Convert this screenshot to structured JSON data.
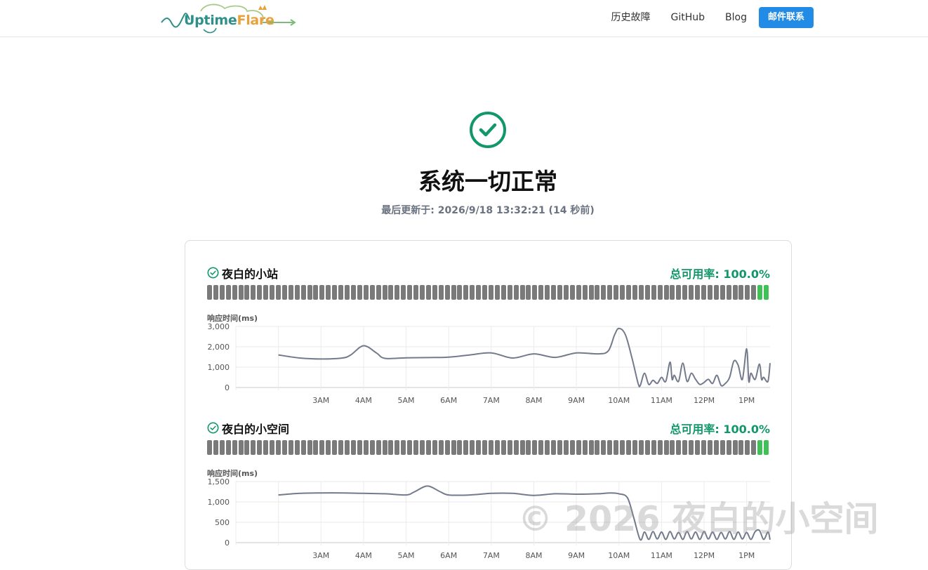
{
  "header": {
    "logo": {
      "part1": "Uptime",
      "part2": "Flare"
    },
    "nav": [
      {
        "label": "历史故障"
      },
      {
        "label": "GitHub"
      },
      {
        "label": "Blog"
      }
    ],
    "contact_button": "邮件联系"
  },
  "status": {
    "icon": "check-circle-icon",
    "title": "系统一切正常",
    "last_updated": "最后更新于: 2026/9/18 13:32:21 (14 秒前)"
  },
  "colors": {
    "accent": "#228be6",
    "ok_green": "#12976b",
    "bar_up": "#40c057",
    "bar_nodata": "#7a7a7a",
    "line": "#737a8c"
  },
  "monitors": [
    {
      "name": "夜白的小站",
      "uptime": "总可用率: 100.0%",
      "chart_data": {
        "type": "line",
        "title": "",
        "ylabel": "响应时间(ms)",
        "yticks": [
          "3,000",
          "2,000",
          "1,000",
          "0"
        ],
        "ylim": [
          0,
          3000
        ],
        "xticks": [
          "3AM",
          "4AM",
          "5AM",
          "6AM",
          "7AM",
          "8AM",
          "9AM",
          "10AM",
          "11AM",
          "12PM",
          "1PM"
        ],
        "x_hours": [
          2.0,
          2.5,
          3.0,
          3.5,
          3.7,
          4.0,
          4.3,
          4.5,
          5.0,
          5.5,
          6.0,
          6.5,
          7.0,
          7.5,
          8.0,
          8.5,
          9.0,
          9.5,
          9.75,
          9.9,
          10.0,
          10.15,
          10.3,
          10.45,
          10.5,
          10.6,
          10.7,
          10.8,
          10.9,
          11.0,
          11.1,
          11.2,
          11.25,
          11.3,
          11.4,
          11.5,
          11.6,
          11.7,
          11.8,
          11.9,
          12.0,
          12.1,
          12.2,
          12.3,
          12.4,
          12.5,
          12.6,
          12.7,
          12.8,
          12.9,
          13.0,
          13.05,
          13.1,
          13.2,
          13.3,
          13.35,
          13.4,
          13.5,
          13.55
        ],
        "values": [
          1600,
          1450,
          1400,
          1450,
          1600,
          2050,
          1700,
          1430,
          1460,
          1470,
          1490,
          1600,
          1700,
          1450,
          1650,
          1480,
          1700,
          1650,
          1800,
          2600,
          2900,
          2600,
          1500,
          200,
          100,
          700,
          150,
          350,
          200,
          500,
          300,
          1250,
          400,
          600,
          300,
          1200,
          300,
          700,
          400,
          150,
          250,
          400,
          200,
          600,
          100,
          200,
          500,
          1300,
          1100,
          400,
          1900,
          300,
          700,
          400,
          1150,
          400,
          500,
          300,
          1200
        ]
      }
    },
    {
      "name": "夜白的小空间",
      "uptime": "总可用率: 100.0%",
      "chart_data": {
        "type": "line",
        "title": "",
        "ylabel": "响应时间(ms)",
        "yticks": [
          "1,500",
          "1,000",
          "500",
          "0"
        ],
        "ylim": [
          0,
          1500
        ],
        "xticks": [
          "3AM",
          "4AM",
          "5AM",
          "6AM",
          "7AM",
          "8AM",
          "9AM",
          "10AM",
          "11AM",
          "12PM",
          "1PM"
        ],
        "x_hours": [
          2.0,
          2.5,
          3.0,
          3.5,
          4.0,
          4.5,
          5.0,
          5.2,
          5.5,
          5.8,
          6.0,
          6.5,
          7.0,
          7.5,
          8.0,
          8.5,
          9.0,
          9.5,
          9.8,
          10.0,
          10.2,
          10.35,
          10.5,
          10.6,
          10.7,
          10.8,
          10.9,
          11.0,
          11.1,
          11.2,
          11.3,
          11.4,
          11.5,
          11.6,
          11.7,
          11.8,
          11.9,
          12.0,
          12.1,
          12.2,
          12.3,
          12.4,
          12.5,
          12.6,
          12.7,
          12.8,
          12.9,
          13.0,
          13.1,
          13.2,
          13.3,
          13.4,
          13.5,
          13.55
        ],
        "values": [
          1170,
          1210,
          1220,
          1220,
          1210,
          1200,
          1170,
          1250,
          1390,
          1250,
          1170,
          1170,
          1210,
          1210,
          1160,
          1200,
          1190,
          1200,
          1220,
          1200,
          1100,
          600,
          70,
          260,
          80,
          270,
          90,
          260,
          80,
          270,
          90,
          250,
          80,
          270,
          90,
          260,
          80,
          270,
          90,
          260,
          80,
          250,
          90,
          270,
          80,
          260,
          90,
          250,
          80,
          270,
          300,
          80,
          260,
          70
        ]
      }
    }
  ],
  "watermark": "© 2026 夜白的小空间"
}
